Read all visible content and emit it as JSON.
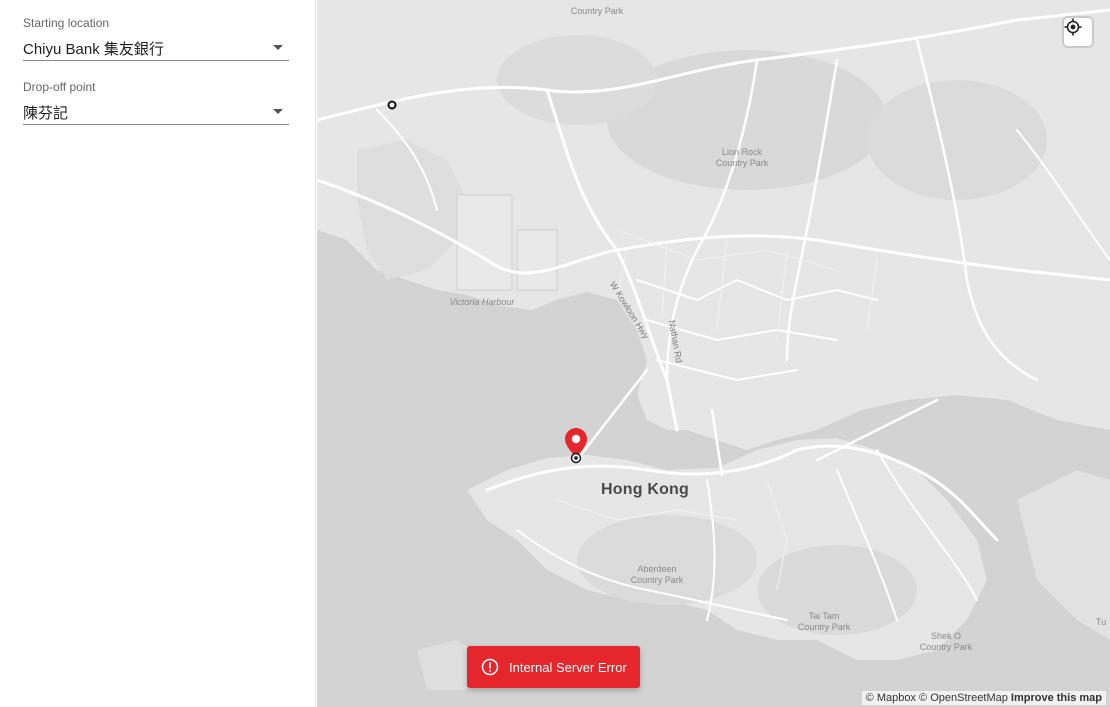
{
  "sidebar": {
    "start": {
      "label": "Starting location",
      "value": "Chiyu Bank 集友銀行"
    },
    "dropoff": {
      "label": "Drop-off point",
      "value": "陳芬記"
    }
  },
  "map": {
    "labels": {
      "country_park_top": "Country Park",
      "lion_rock_1": "Lion Rock",
      "lion_rock_2": "Country Park",
      "victoria_harbour": "Victoria Harbour",
      "w_kowloon_hwy": "W Kowloon Hwy",
      "nathan_rd": "Nathan Rd",
      "hong_kong": "Hong Kong",
      "aberdeen_1": "Aberdeen",
      "aberdeen_2": "Country Park",
      "tai_tam_1": "Tai Tam",
      "tai_tam_2": "Country Park",
      "shek_o_1": "Shek O",
      "shek_o_2": "Country Park",
      "tu_partial": "Tu"
    },
    "attribution": {
      "mapbox": "© Mapbox",
      "osm": "© OpenStreetMap",
      "improve": "Improve this map"
    },
    "marker_icon": "map-pin-icon",
    "locate_icon": "crosshair-icon"
  },
  "toast": {
    "message": "Internal Server Error",
    "icon": "alert-circle-icon"
  },
  "colors": {
    "error": "#e5262c",
    "water": "#d3d3d3",
    "land": "#e6e6e6"
  }
}
